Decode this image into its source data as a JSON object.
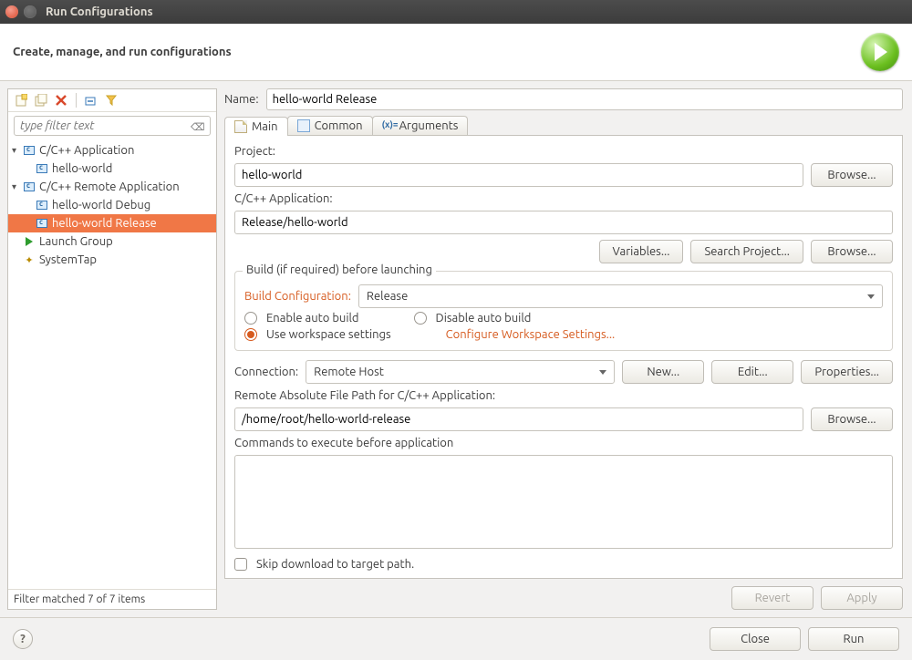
{
  "window": {
    "title": "Run Configurations"
  },
  "header": {
    "title": "Create, manage, and run configurations"
  },
  "left_toolbar": {
    "new_icon": "new-config-icon",
    "dup_icon": "duplicate-config-icon",
    "del_icon": "delete-config-icon",
    "collapse_icon": "collapse-all-icon",
    "filter_icon": "filter-launch-icon"
  },
  "filter": {
    "placeholder": "type filter text"
  },
  "tree": [
    {
      "label": "C/C++ Application",
      "kind": "c",
      "depth": 0,
      "expand": "▾"
    },
    {
      "label": "hello-world",
      "kind": "c",
      "depth": 1
    },
    {
      "label": "C/C++ Remote Application",
      "kind": "c",
      "depth": 0,
      "expand": "▾"
    },
    {
      "label": "hello-world Debug",
      "kind": "c",
      "depth": 1
    },
    {
      "label": "hello-world Release",
      "kind": "c",
      "depth": 1,
      "selected": true
    },
    {
      "label": "Launch Group",
      "kind": "play",
      "depth": 0
    },
    {
      "label": "SystemTap",
      "kind": "stap",
      "depth": 0
    }
  ],
  "left_status": "Filter matched 7 of 7 items",
  "name": {
    "label": "Name:",
    "value": "hello-world Release"
  },
  "tabs": [
    {
      "id": "main",
      "label": "Main",
      "icon": "doc",
      "active": true
    },
    {
      "id": "common",
      "label": "Common",
      "icon": "common"
    },
    {
      "id": "arguments",
      "label": "Arguments",
      "icon": "args"
    }
  ],
  "main": {
    "project_label": "Project:",
    "project_value": "hello-world",
    "project_browse": "Browse...",
    "app_label": "C/C++ Application:",
    "app_value": "Release/hello-world",
    "variables": "Variables...",
    "search_project": "Search Project...",
    "app_browse": "Browse...",
    "build_group": "Build (if required) before launching",
    "build_cfg_label": "Build Configuration:",
    "build_cfg_value": "Release",
    "enable_auto": "Enable auto build",
    "disable_auto": "Disable auto build",
    "use_workspace": "Use workspace settings",
    "cfg_ws_link": "Configure Workspace Settings...",
    "connection_label": "Connection:",
    "connection_value": "Remote Host",
    "new_btn": "New...",
    "edit_btn": "Edit...",
    "props_btn": "Properties...",
    "remote_path_label": "Remote Absolute File Path for C/C++ Application:",
    "remote_path_value": "/home/root/hello-world-release",
    "remote_browse": "Browse...",
    "pre_cmds_label": "Commands to execute before application",
    "pre_cmds_value": "",
    "skip_dl": "Skip download to target path."
  },
  "apply": {
    "revert": "Revert",
    "apply": "Apply"
  },
  "footer": {
    "close": "Close",
    "run": "Run"
  }
}
